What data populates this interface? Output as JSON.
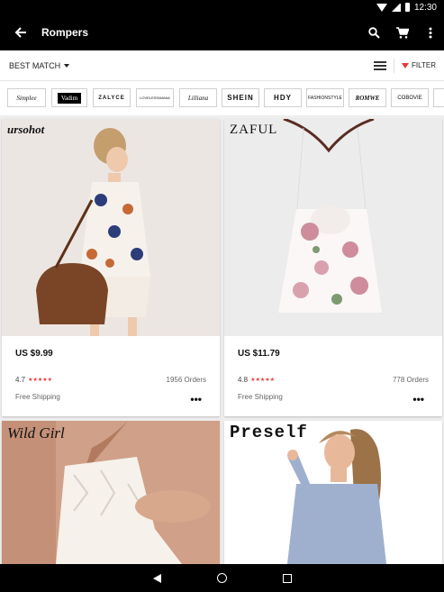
{
  "status": {
    "time": "12:30"
  },
  "toolbar": {
    "title": "Rompers"
  },
  "sort": {
    "label": "BEST MATCH",
    "filter_label": "FILTER"
  },
  "brands": [
    "Simplee",
    "Vadim",
    "ZALYCE",
    "LOVELESSMANIA",
    "Lilliana",
    "SHEIN",
    "HDY",
    "FASHIONSTYLE",
    "ROMWE",
    "COBOVIE"
  ],
  "products": [
    {
      "brand": "ursohot",
      "price": "US $9.99",
      "rating": "4.7",
      "stars": "★★★★★",
      "orders": "1956 Orders",
      "shipping": "Free Shipping",
      "more": "•••"
    },
    {
      "brand": "ZAFUL",
      "price": "US $11.79",
      "rating": "4.8",
      "stars": "★★★★★",
      "orders": "778 Orders",
      "shipping": "Free Shipping",
      "more": "•••"
    },
    {
      "brand": "Wild Girl"
    },
    {
      "brand": "Preself"
    }
  ]
}
